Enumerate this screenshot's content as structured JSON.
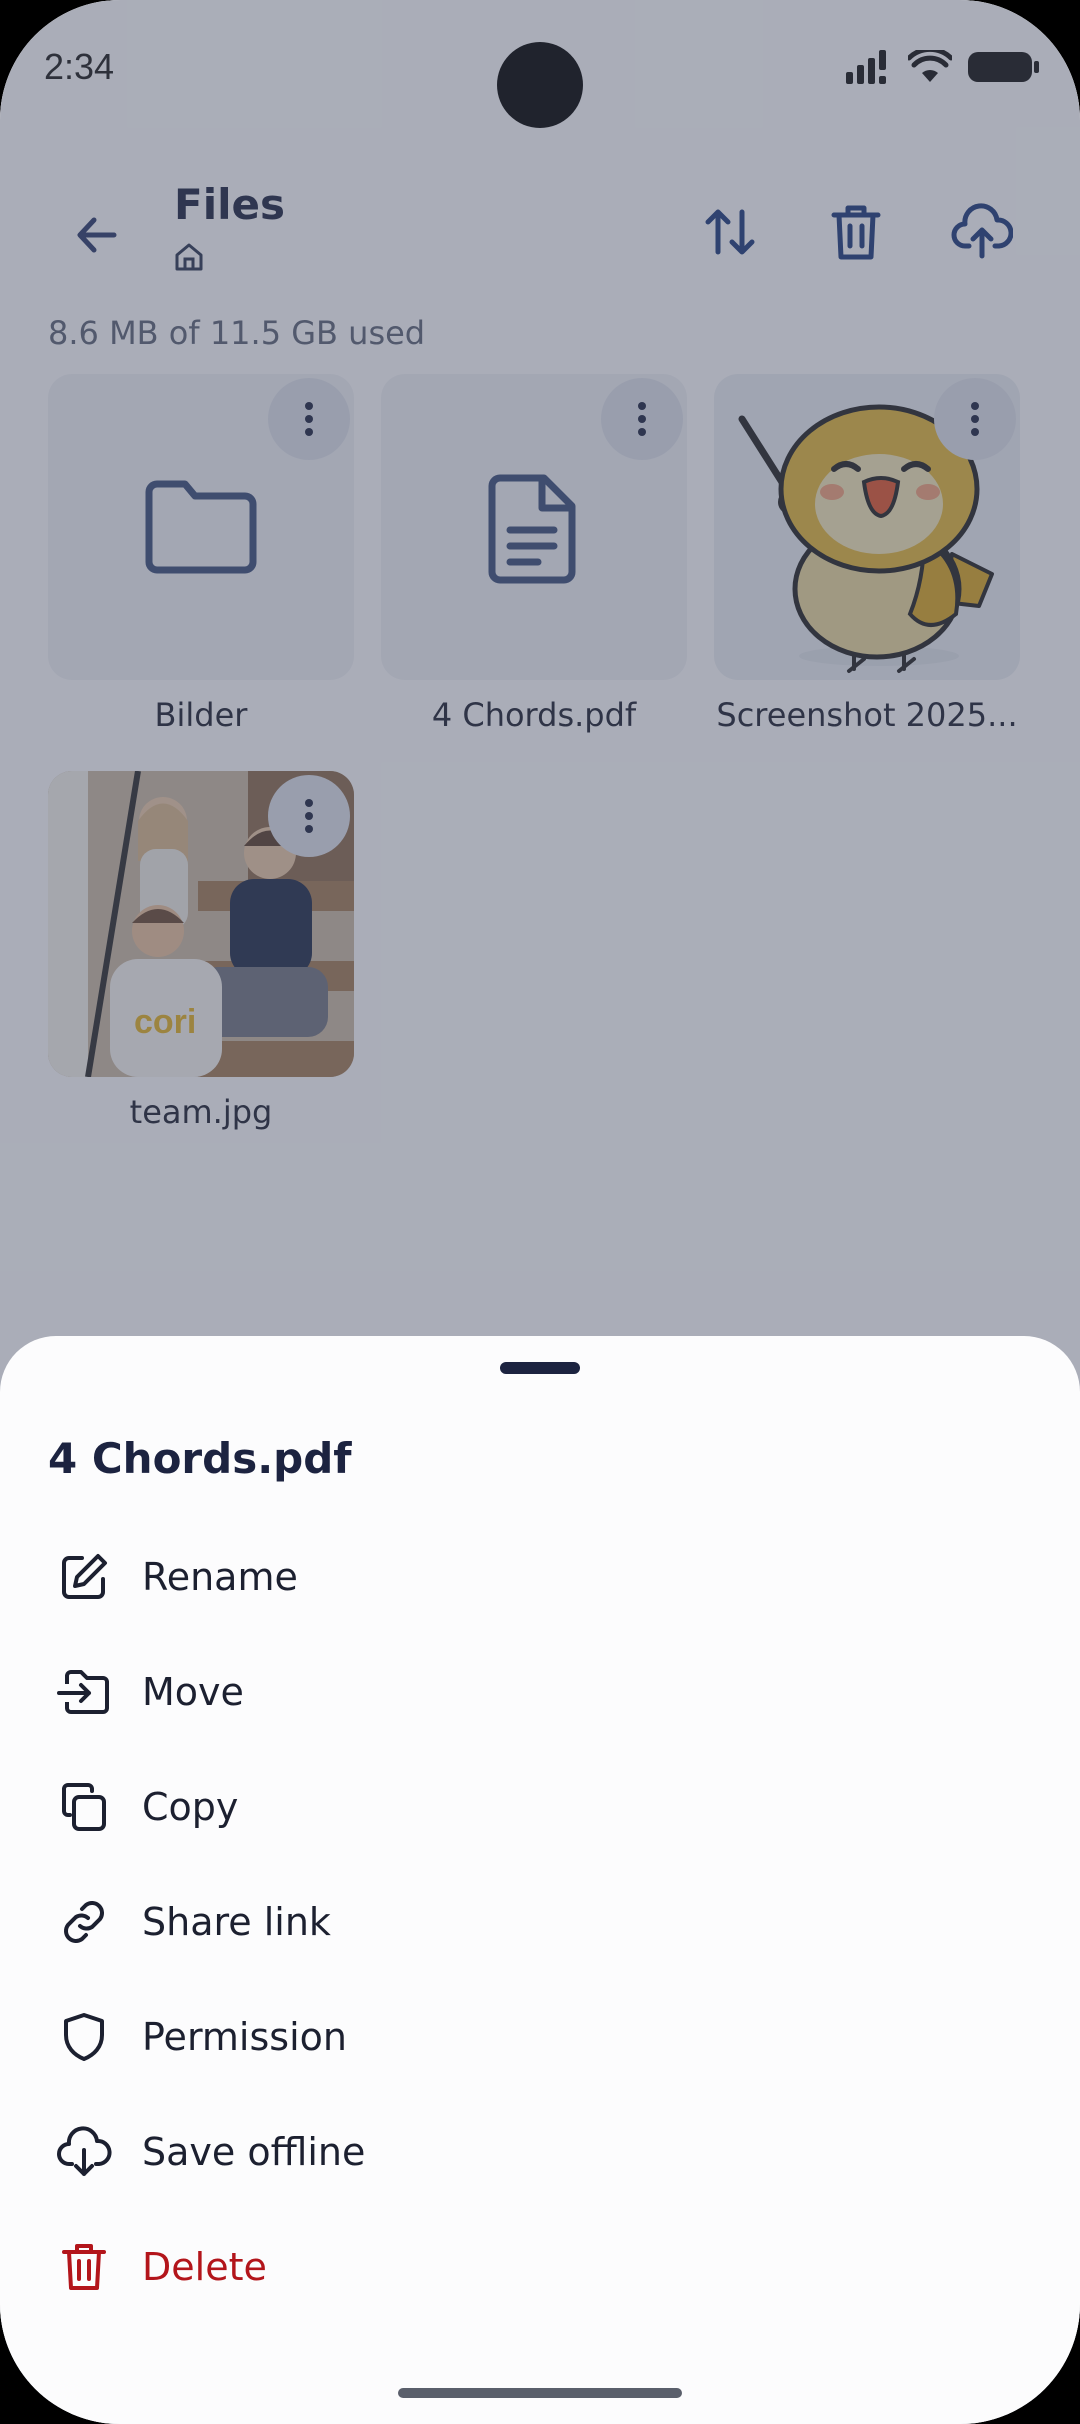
{
  "status": {
    "time": "2:34"
  },
  "appbar": {
    "title": "Files"
  },
  "storage": {
    "text": "8.6 MB of 11.5 GB used"
  },
  "files": [
    {
      "name": "Bilder",
      "type": "folder"
    },
    {
      "name": "4 Chords.pdf",
      "type": "document"
    },
    {
      "name": "Screenshot 2025...",
      "type": "image"
    },
    {
      "name": "team.jpg",
      "type": "image",
      "shirt_text": "cori"
    }
  ],
  "sheet": {
    "title": "4 Chords.pdf",
    "items": [
      {
        "label": "Rename",
        "icon": "edit-icon"
      },
      {
        "label": "Move",
        "icon": "move-icon"
      },
      {
        "label": "Copy",
        "icon": "copy-icon"
      },
      {
        "label": "Share link",
        "icon": "link-icon"
      },
      {
        "label": "Permission",
        "icon": "shield-icon"
      },
      {
        "label": "Save offline",
        "icon": "cloud-download-icon"
      },
      {
        "label": "Delete",
        "icon": "trash-icon"
      }
    ]
  },
  "colors": {
    "accent": "#1c3a7a",
    "danger": "#b3151b",
    "text": "#1c2030"
  }
}
